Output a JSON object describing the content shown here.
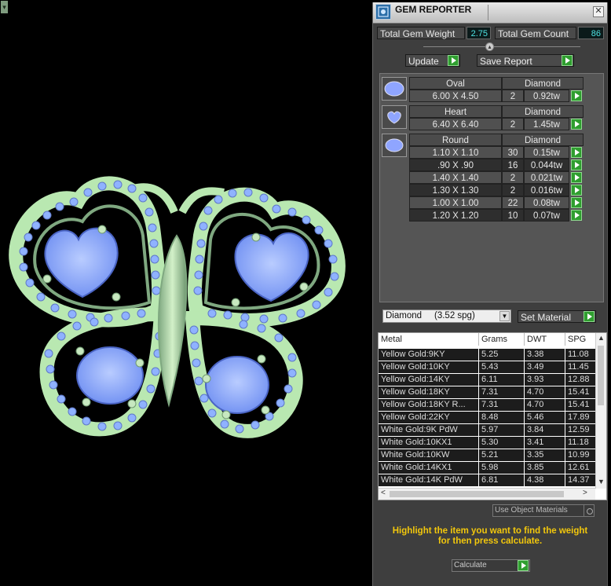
{
  "window": {
    "title": "GEM REPORTER",
    "close_glyph": "✕",
    "corner_glyph": "▾"
  },
  "totals": {
    "weight_label": "Total Gem Weight",
    "weight_value": "2.75",
    "count_label": "Total Gem Count",
    "count_value": "86"
  },
  "actions": {
    "update_label": "Update",
    "save_label": "Save Report"
  },
  "gems": [
    {
      "shape": "Oval",
      "type": "Diamond",
      "rows": [
        {
          "size": "6.00 X 4.50",
          "count": "2",
          "weight": "0.92tw"
        }
      ]
    },
    {
      "shape": "Heart",
      "type": "Diamond",
      "rows": [
        {
          "size": "6.40 X 6.40",
          "count": "2",
          "weight": "1.45tw"
        }
      ]
    },
    {
      "shape": "Round",
      "type": "Diamond",
      "rows": [
        {
          "size": "1.10 X 1.10",
          "count": "30",
          "weight": "0.15tw"
        },
        {
          "size": ".90 X .90",
          "count": "16",
          "weight": "0.044tw"
        },
        {
          "size": "1.40 X 1.40",
          "count": "2",
          "weight": "0.021tw"
        },
        {
          "size": "1.30 X 1.30",
          "count": "2",
          "weight": "0.016tw"
        },
        {
          "size": "1.00 X 1.00",
          "count": "22",
          "weight": "0.08tw"
        },
        {
          "size": "1.20 X 1.20",
          "count": "10",
          "weight": "0.07tw"
        }
      ]
    }
  ],
  "material": {
    "selected": "Diamond     (3.52 spg)",
    "set_label": "Set Material"
  },
  "metal_table": {
    "headers": [
      "Metal",
      "Grams",
      "DWT",
      "SPG"
    ],
    "rows": [
      [
        "Yellow Gold:9KY",
        "5.25",
        "3.38",
        "11.08"
      ],
      [
        "Yellow Gold:10KY",
        "5.43",
        "3.49",
        "11.45"
      ],
      [
        "Yellow Gold:14KY",
        "6.11",
        "3.93",
        "12.88"
      ],
      [
        "Yellow Gold:18KY",
        "7.31",
        "4.70",
        "15.41"
      ],
      [
        "Yellow Gold:18KY R...",
        "7.31",
        "4.70",
        "15.41"
      ],
      [
        "Yellow Gold:22KY",
        "8.48",
        "5.46",
        "17.89"
      ],
      [
        "White Gold:9K PdW",
        "5.97",
        "3.84",
        "12.59"
      ],
      [
        "White Gold:10KX1",
        "5.30",
        "3.41",
        "11.18"
      ],
      [
        "White Gold:10KW",
        "5.21",
        "3.35",
        "10.99"
      ],
      [
        "White Gold:14KX1",
        "5.98",
        "3.85",
        "12.61"
      ],
      [
        "White Gold:14K PdW",
        "6.81",
        "4.38",
        "14.37"
      ]
    ]
  },
  "footer": {
    "use_object_materials": "Use Object Materials",
    "hint_line1": "Highlight the item you want to find the weight",
    "hint_line2": "for then press calculate.",
    "calculate_label": "Calculate"
  },
  "colors": {
    "metal_green": "#b9e8b1",
    "gem_blue": "#8fb2ff",
    "accent_cyan": "#4fe3e3",
    "hint_yellow": "#f2c70c",
    "go_green": "#2f9e2f"
  }
}
